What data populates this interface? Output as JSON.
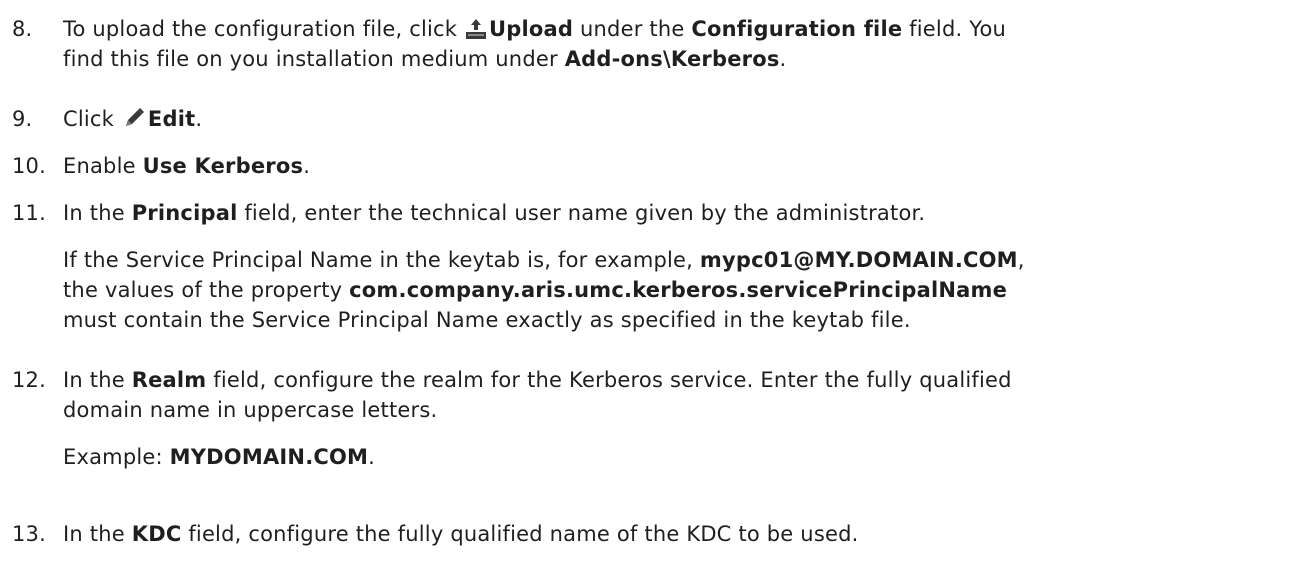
{
  "steps": [
    {
      "number": "8.",
      "line1": {
        "a": "To upload the configuration file, click ",
        "icon": "upload-icon",
        "b1": "Upload",
        "c": " under the ",
        "b2": "Configuration file",
        "d": " field. You"
      },
      "line2": {
        "a": "find this file on you installation medium under ",
        "b1": "Add-ons\\Kerberos",
        "c": "."
      }
    },
    {
      "number": "9.",
      "line1": {
        "a": "Click ",
        "icon": "edit-pencil-icon",
        "b1": "Edit",
        "c": "."
      }
    },
    {
      "number": "10.",
      "line1": {
        "a": "Enable ",
        "b1": "Use Kerberos",
        "c": "."
      }
    },
    {
      "number": "11.",
      "line1": {
        "a": "In the ",
        "b1": "Principal",
        "c": " field, enter the technical user name given by the administrator."
      },
      "note": {
        "l1a": "If the Service Principal Name in the keytab is, for example, ",
        "l1b": "mypc01@MY.DOMAIN.COM",
        "l1c": ",",
        "l2a": "the values of the property ",
        "l2b": "com.company.aris.umc.kerberos.servicePrincipalName",
        "l3a": "must contain the Service Principal Name exactly as specified in the keytab file."
      }
    },
    {
      "number": "12.",
      "line1": {
        "a": "In the ",
        "b1": "Realm",
        "c": " field, configure the realm for the Kerberos service. Enter the fully qualified"
      },
      "line2": {
        "a": "domain name in uppercase letters."
      },
      "example": {
        "a": "Example: ",
        "b1": "MYDOMAIN.COM",
        "c": "."
      }
    },
    {
      "number": "13.",
      "line1": {
        "a": "In the ",
        "b1": "KDC",
        "c": " field, configure the fully qualified name of the KDC to be used."
      }
    }
  ]
}
